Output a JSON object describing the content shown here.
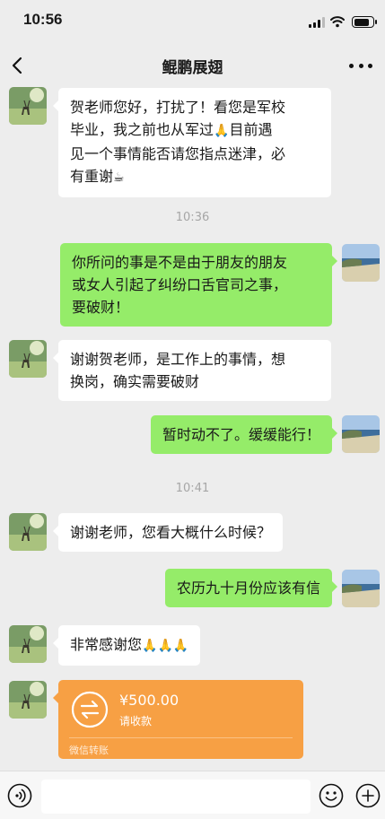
{
  "status_bar": {
    "time": "10:56"
  },
  "header": {
    "title": "鲲鹏展翅"
  },
  "messages": [
    {
      "line1": "贺老师您好，打扰了！看您是军校",
      "line2": "毕业，我之前也从军过",
      "emoji2": "🙏",
      "line2b": "目前遇",
      "line3": "见一个事情能否请您指点迷津，必",
      "line4": "有重谢",
      "emoji4": "☕"
    },
    {
      "line1": "你所问的事是不是由于朋友的朋友",
      "line2": "或女人引起了纠纷口舌官司之事，",
      "line3": "要破财！"
    },
    {
      "line1": "谢谢贺老师，是工作上的事情，想",
      "line2": "换岗，确实需要破财"
    },
    {
      "text": "暂时动不了。缓缓能行！"
    },
    {
      "text": "谢谢老师，您看大概什么时候？"
    },
    {
      "text": "农历九十月份应该有信"
    },
    {
      "text": "非常感谢您",
      "emoji": "🙏🙏🙏"
    }
  ],
  "time_dividers": [
    "10:36",
    "10:41"
  ],
  "transfer": {
    "amount": "¥500.00",
    "status": "请收款",
    "footer": "微信转账"
  },
  "icons": {
    "back": "chevron-left-icon",
    "more": "more-dots-icon",
    "voice": "voice-icon",
    "emoji": "emoji-icon",
    "plus": "plus-icon",
    "transfer": "transfer-arrows-icon"
  },
  "colors": {
    "outgoing_bubble": "#95ec69",
    "incoming_bubble": "#ffffff",
    "transfer": "#f7a044",
    "background": "#ededed"
  }
}
